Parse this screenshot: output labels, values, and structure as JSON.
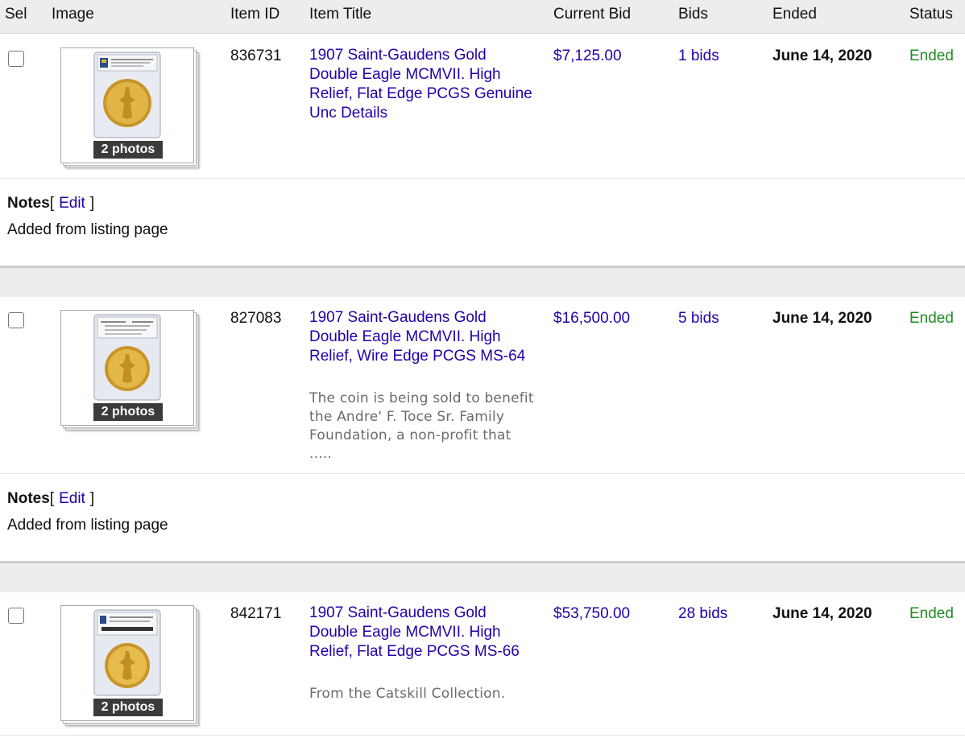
{
  "columns": {
    "sel": "Sel",
    "image": "Image",
    "item_id": "Item ID",
    "item_title": "Item Title",
    "current_bid": "Current Bid",
    "bids": "Bids",
    "ended": "Ended",
    "status": "Status"
  },
  "colors": {
    "link": "#2200aa",
    "status_ended": "#228b22",
    "header_bg": "#ededed",
    "photo_badge_bg": "#3b3b3b",
    "coin_gold": "#d4a32a"
  },
  "items": [
    {
      "photos_label": "2 photos",
      "item_id": "836731",
      "title": "1907 Saint-Gaudens Gold Double Eagle MCMVII. High Relief, Flat Edge PCGS Genuine Unc Details",
      "description": "",
      "current_bid": "$7,125.00",
      "bids": "1 bids",
      "ended": "June 14, 2020",
      "status": "Ended",
      "notes_label": "Notes",
      "notes_bracket_open": "[",
      "notes_edit": "Edit",
      "notes_bracket_close": "]",
      "notes_text": "Added from listing page",
      "thumb_icon": "pcgs-gold-coin-slab-image"
    },
    {
      "photos_label": "2 photos",
      "item_id": "827083",
      "title": "1907 Saint-Gaudens Gold Double Eagle MCMVII. High Relief, Wire Edge PCGS MS-64",
      "description": "The coin is being sold to benefit the Andre' F. Toce Sr. Family Foundation, a non-profit that .....",
      "current_bid": "$16,500.00",
      "bids": "5 bids",
      "ended": "June 14, 2020",
      "status": "Ended",
      "notes_label": "Notes",
      "notes_bracket_open": "[",
      "notes_edit": "Edit",
      "notes_bracket_close": "]",
      "notes_text": "Added from listing page",
      "thumb_icon": "pcgs-gold-coin-slab-image"
    },
    {
      "photos_label": "2 photos",
      "item_id": "842171",
      "title": "1907 Saint-Gaudens Gold Double Eagle MCMVII. High Relief, Flat Edge PCGS MS-66",
      "description": "From the Catskill Collection.",
      "current_bid": "$53,750.00",
      "bids": "28 bids",
      "ended": "June 14, 2020",
      "status": "Ended",
      "notes_label": "",
      "notes_bracket_open": "",
      "notes_edit": "",
      "notes_bracket_close": "",
      "notes_text": "",
      "thumb_icon": "pcgs-gold-coin-slab-image"
    }
  ]
}
